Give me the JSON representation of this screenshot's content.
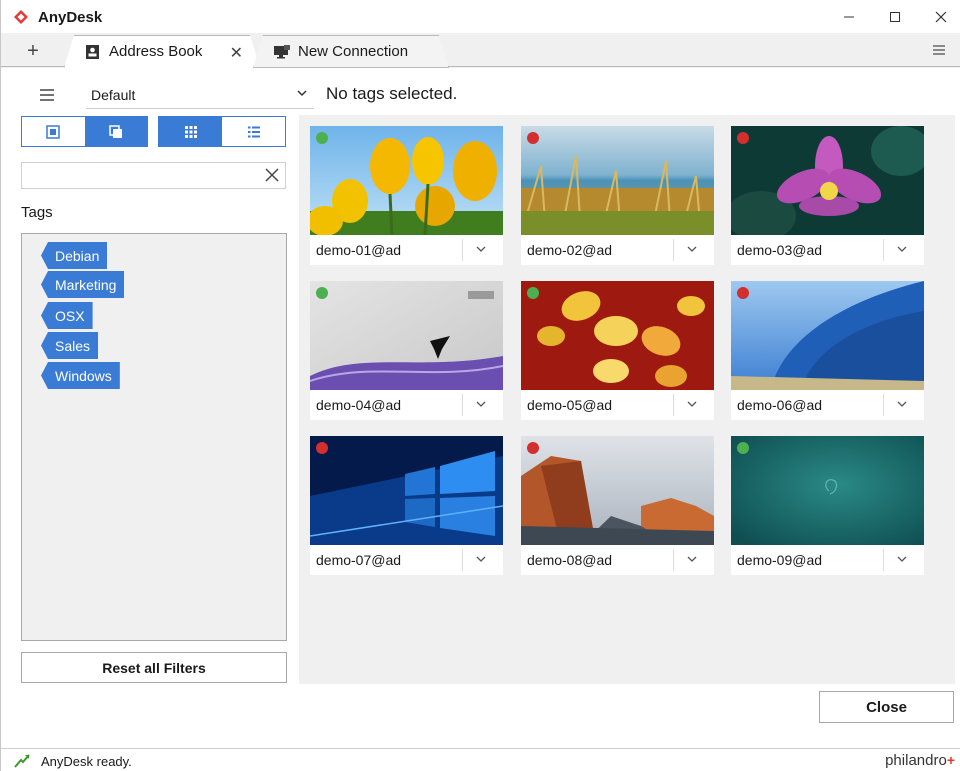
{
  "window": {
    "title": "AnyDesk",
    "controls": {
      "minimize": "—",
      "maximize": "☐",
      "close": "✕"
    }
  },
  "tabs": {
    "add": "+",
    "items": [
      {
        "label": "Address Book",
        "icon": "address-book-icon",
        "active": true,
        "close": "✕"
      },
      {
        "label": "New Connection",
        "icon": "monitor-icon",
        "active": false
      }
    ]
  },
  "toolbar": {
    "address_book_select": "Default",
    "tag_status": "No tags selected."
  },
  "search": {
    "value": "",
    "placeholder": ""
  },
  "tags": {
    "heading": "Tags",
    "items": [
      "Debian",
      "Marketing",
      "OSX",
      "Sales",
      "Windows"
    ]
  },
  "buttons": {
    "reset_filters": "Reset all Filters",
    "close": "Close"
  },
  "devices": [
    {
      "name": "demo-01@ad",
      "online": true
    },
    {
      "name": "demo-02@ad",
      "online": false
    },
    {
      "name": "demo-03@ad",
      "online": false
    },
    {
      "name": "demo-04@ad",
      "online": true
    },
    {
      "name": "demo-05@ad",
      "online": true
    },
    {
      "name": "demo-06@ad",
      "online": false
    },
    {
      "name": "demo-07@ad",
      "online": false
    },
    {
      "name": "demo-08@ad",
      "online": false
    },
    {
      "name": "demo-09@ad",
      "online": true
    }
  ],
  "status": {
    "text": "AnyDesk ready.",
    "brand": "philandro",
    "brand_mark": "+"
  },
  "colors": {
    "accent": "#3a7bd5",
    "online": "#4caf50",
    "offline": "#d32f2f",
    "brand_red": "#e53935"
  }
}
